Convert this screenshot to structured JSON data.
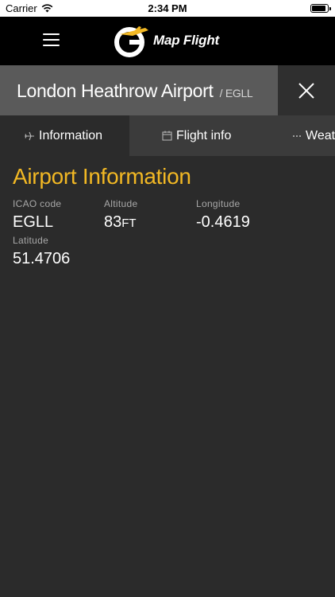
{
  "status_bar": {
    "carrier": "Carrier",
    "time": "2:34 PM"
  },
  "nav": {
    "logo_text": "Map Flight"
  },
  "header": {
    "airport_name": "London Heathrow Airport",
    "airport_code": "/ EGLL"
  },
  "tabs": [
    {
      "label": "Information",
      "icon": "plane-icon",
      "active": true
    },
    {
      "label": "Flight info",
      "icon": "calendar-icon",
      "active": false
    },
    {
      "label": "Weat",
      "icon": "more-icon",
      "active": false
    }
  ],
  "main": {
    "section_title": "Airport Information",
    "fields": {
      "icao": {
        "label": "ICAO code",
        "value": "EGLL"
      },
      "altitude": {
        "label": "Altitude",
        "value": "83",
        "unit": "FT"
      },
      "longitude": {
        "label": "Longitude",
        "value": "-0.4619"
      },
      "latitude": {
        "label": "Latitude",
        "value": "51.4706"
      }
    }
  },
  "colors": {
    "accent": "#f2b824",
    "background": "#2b2b2b",
    "title_bar": "#5a5a5a",
    "tab_bar": "#3b3b3b"
  }
}
